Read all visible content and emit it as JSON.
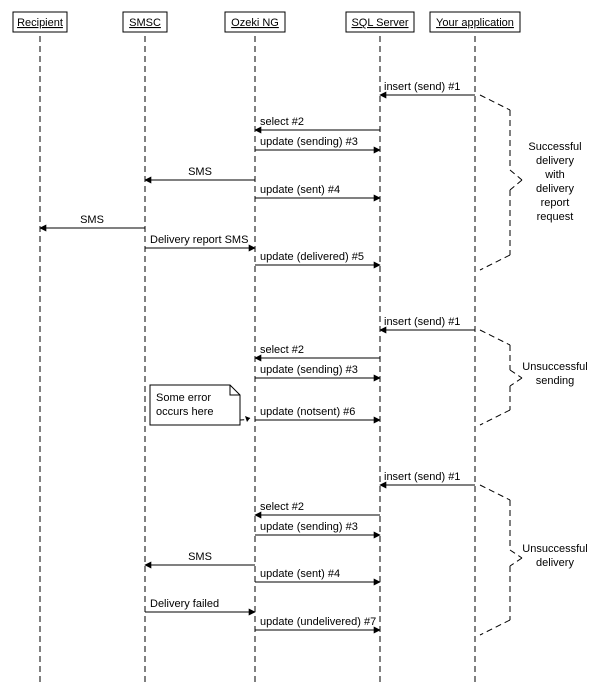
{
  "actors": {
    "recipient": "Recipient",
    "smsc": "SMSC",
    "ozeki": "Ozeki NG",
    "sql": "SQL Server",
    "app": "Your application"
  },
  "messages": {
    "insert_send": "insert (send) #1",
    "select": "select #2",
    "update_sending": "update (sending) #3",
    "sms": "SMS",
    "update_sent": "update (sent) #4",
    "delivery_report_sms": "Delivery report SMS",
    "update_delivered": "update (delivered) #5",
    "update_notsent": "update (notsent) #6",
    "delivery_failed": "Delivery failed",
    "update_undelivered": "update (undelivered) #7"
  },
  "note": {
    "line1": "Some error",
    "line2": "occurs here"
  },
  "groups": {
    "success": {
      "l1": "Successful",
      "l2": "delivery",
      "l3": "with",
      "l4": "delivery",
      "l5": "report",
      "l6": "request"
    },
    "unsend": {
      "l1": "Unsuccessful",
      "l2": "sending"
    },
    "undeliv": {
      "l1": "Unsuccessful",
      "l2": "delivery"
    }
  }
}
